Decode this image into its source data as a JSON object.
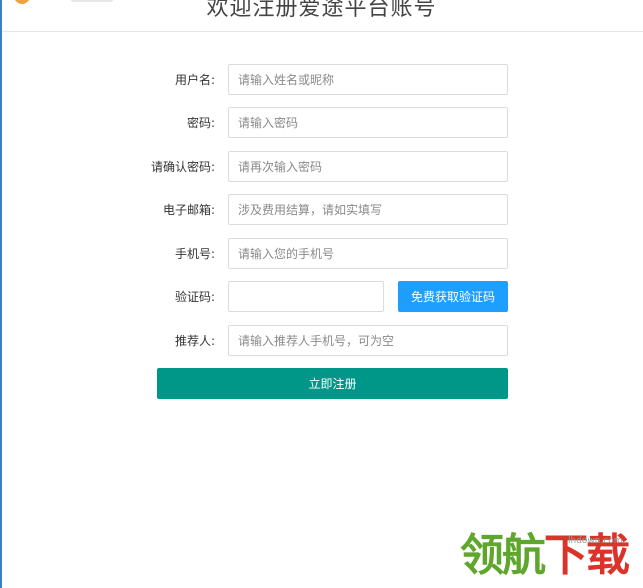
{
  "page": {
    "title": "欢迎注册爱途平台账号"
  },
  "form": {
    "username": {
      "label": "用户名:",
      "placeholder": "请输入姓名或昵称"
    },
    "password": {
      "label": "密码:",
      "placeholder": "请输入密码"
    },
    "confirm_password": {
      "label": "请确认密码:",
      "placeholder": "请再次输入密码"
    },
    "email": {
      "label": "电子邮箱:",
      "placeholder": "涉及费用结算，请如实填写"
    },
    "phone": {
      "label": "手机号:",
      "placeholder": "请输入您的手机号"
    },
    "verification_code": {
      "label": "验证码:",
      "value": "",
      "button_label": "免费获取验证码"
    },
    "referrer": {
      "label": "推荐人:",
      "placeholder": "请输入推荐人手机号，可为空"
    },
    "submit_label": "立即注册"
  },
  "watermark": {
    "text_green": "领航",
    "text_red": "下载",
    "url": "lhdown.com"
  },
  "colors": {
    "primary_button": "#009688",
    "code_button": "#1e9fff",
    "watermark_green": "#5fa62c",
    "watermark_red": "#d9332a"
  },
  "icons": {
    "logo": "brand-logo-icon"
  }
}
